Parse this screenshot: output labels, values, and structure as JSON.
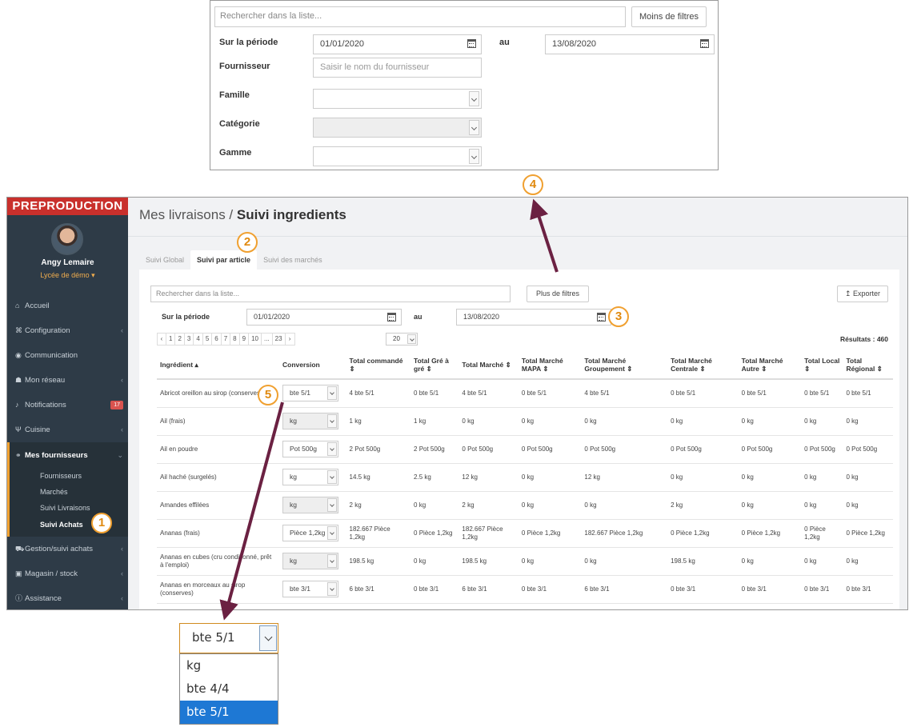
{
  "filter_panel": {
    "search_placeholder": "Rechercher dans la liste...",
    "less_filters_label": "Moins de filtres",
    "period_label": "Sur la période",
    "date_from": "01/01/2020",
    "to_label": "au",
    "date_to": "13/08/2020",
    "supplier_label": "Fournisseur",
    "supplier_placeholder": "Saisir le nom du fournisseur",
    "family_label": "Famille",
    "category_label": "Catégorie",
    "range_label": "Gamme"
  },
  "callouts": [
    "1",
    "2",
    "3",
    "4",
    "5"
  ],
  "sidebar": {
    "env_banner": "PREPRODUCTION",
    "user_name": "Angy Lemaire",
    "school": "Lycée de démo ▾",
    "items": [
      {
        "label": "Accueil",
        "icon": "home-icon",
        "glyph": "⌂"
      },
      {
        "label": "Configuration",
        "icon": "bank-icon",
        "glyph": "⌘"
      },
      {
        "label": "Communication",
        "icon": "comments-icon",
        "glyph": "◉"
      },
      {
        "label": "Mon réseau",
        "icon": "users-icon",
        "glyph": "☗"
      },
      {
        "label": "Notifications",
        "icon": "bell-icon",
        "glyph": "♪",
        "badge": "17"
      },
      {
        "label": "Cuisine",
        "icon": "cutlery-icon",
        "glyph": "Ψ"
      },
      {
        "label": "Mes fournisseurs",
        "icon": "handshake-icon",
        "glyph": "⚭"
      },
      {
        "label": "Gestion/suivi achats",
        "icon": "cart-icon",
        "glyph": "⛟"
      },
      {
        "label": "Magasin / stock",
        "icon": "cubes-icon",
        "glyph": "▣"
      },
      {
        "label": "Assistance",
        "icon": "info-icon",
        "glyph": "ⓘ"
      }
    ],
    "subitems": [
      "Fournisseurs",
      "Marchés",
      "Suivi Livraisons",
      "Suivi Achats"
    ]
  },
  "main": {
    "breadcrumb_prefix": "Mes livraisons / ",
    "title": "Suivi ingredients",
    "tabs": [
      "Suivi Global",
      "Suivi par article",
      "Suivi des marchés"
    ],
    "search_placeholder": "Rechercher dans la liste...",
    "more_filters_label": "Plus de filtres",
    "export_label": "↥ Exporter",
    "period_label": "Sur la période",
    "date_from": "01/01/2020",
    "to_label": "au",
    "date_to": "13/08/2020",
    "pagination": [
      "‹",
      "1",
      "2",
      "3",
      "4",
      "5",
      "6",
      "7",
      "8",
      "9",
      "10",
      "...",
      "23",
      "›"
    ],
    "per_page": "20",
    "results": "Résultats : 460"
  },
  "table": {
    "headers": [
      "Ingrédient ▴",
      "Conversion",
      "Total commandé ⇕",
      "Total Gré à gré ⇕",
      "Total Marché ⇕",
      "Total Marché MAPA ⇕",
      "Total Marché Groupement ⇕",
      "Total Marché Centrale ⇕",
      "Total Marché Autre ⇕",
      "Total Local ⇕",
      "Total Régional ⇕"
    ],
    "rows": [
      {
        "ingredient": "Abricot oreillon au sirop (conserves)",
        "conversion": "bte 5/1",
        "disabled": false,
        "values": [
          "4 bte 5/1",
          "0 bte 5/1",
          "4 bte 5/1",
          "0 bte 5/1",
          "4 bte 5/1",
          "0 bte 5/1",
          "0 bte 5/1",
          "0 bte 5/1",
          "0 bte 5/1"
        ]
      },
      {
        "ingredient": "Ail (frais)",
        "conversion": "kg",
        "disabled": true,
        "values": [
          "1 kg",
          "1 kg",
          "0 kg",
          "0 kg",
          "0 kg",
          "0 kg",
          "0 kg",
          "0 kg",
          "0 kg"
        ]
      },
      {
        "ingredient": "Ail en poudre",
        "conversion": "Pot 500g",
        "disabled": false,
        "values": [
          "2 Pot 500g",
          "2 Pot 500g",
          "0 Pot 500g",
          "0 Pot 500g",
          "0 Pot 500g",
          "0 Pot 500g",
          "0 Pot 500g",
          "0 Pot 500g",
          "0 Pot 500g"
        ]
      },
      {
        "ingredient": "Ail haché (surgelés)",
        "conversion": "kg",
        "disabled": false,
        "values": [
          "14.5 kg",
          "2.5 kg",
          "12 kg",
          "0 kg",
          "12 kg",
          "0 kg",
          "0 kg",
          "0 kg",
          "0 kg"
        ]
      },
      {
        "ingredient": "Amandes effilées",
        "conversion": "kg",
        "disabled": true,
        "values": [
          "2 kg",
          "0 kg",
          "2 kg",
          "0 kg",
          "0 kg",
          "2 kg",
          "0 kg",
          "0 kg",
          "0 kg"
        ]
      },
      {
        "ingredient": "Ananas (frais)",
        "conversion": "Pièce 1,2kg",
        "disabled": false,
        "values": [
          "182.667 Pièce 1,2kg",
          "0 Pièce 1,2kg",
          "182.667 Pièce 1,2kg",
          "0 Pièce 1,2kg",
          "182.667 Pièce 1,2kg",
          "0 Pièce 1,2kg",
          "0 Pièce 1,2kg",
          "0 Pièce 1,2kg",
          "0 Pièce 1,2kg"
        ]
      },
      {
        "ingredient": "Ananas en cubes (cru conditionné, prêt à l'emploi)",
        "conversion": "kg",
        "disabled": true,
        "values": [
          "198.5 kg",
          "0 kg",
          "198.5 kg",
          "0 kg",
          "0 kg",
          "198.5 kg",
          "0 kg",
          "0 kg",
          "0 kg"
        ]
      },
      {
        "ingredient": "Ananas en morceaux au sirop (conserves)",
        "conversion": "bte 3/1",
        "disabled": false,
        "values": [
          "6 bte 3/1",
          "0 bte 3/1",
          "6 bte 3/1",
          "0 bte 3/1",
          "6 bte 3/1",
          "0 bte 3/1",
          "0 bte 3/1",
          "0 bte 3/1",
          "0 bte 3/1"
        ]
      }
    ]
  },
  "dropdown": {
    "selected": "bte 5/1",
    "options": [
      "kg",
      "bte 4/4",
      "bte 5/1"
    ]
  },
  "colors": {
    "accent": "#f0a030",
    "arrow": "#6b2142",
    "sidebar": "#2e3b47",
    "banner": "#c9302c",
    "selected_option": "#1e78d4"
  }
}
